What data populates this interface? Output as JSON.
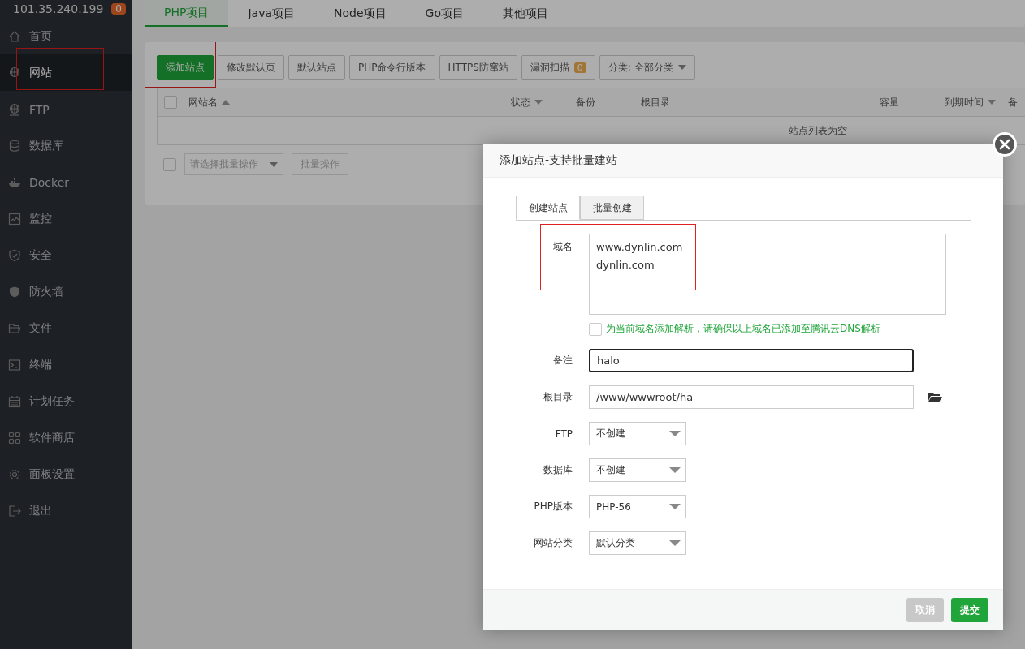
{
  "server": {
    "address": "101.35.240.199",
    "badge": "0"
  },
  "sidebar": {
    "items": [
      {
        "label": "首页",
        "selected": false,
        "highlighted": false
      },
      {
        "label": "网站",
        "selected": true,
        "highlighted": true
      },
      {
        "label": "FTP",
        "selected": false,
        "highlighted": false
      },
      {
        "label": "数据库",
        "selected": false,
        "highlighted": false
      },
      {
        "label": "Docker",
        "selected": false,
        "highlighted": false
      },
      {
        "label": "监控",
        "selected": false,
        "highlighted": false
      },
      {
        "label": "安全",
        "selected": false,
        "highlighted": false
      },
      {
        "label": "防火墙",
        "selected": false,
        "highlighted": false
      },
      {
        "label": "文件",
        "selected": false,
        "highlighted": false
      },
      {
        "label": "终端",
        "selected": false,
        "highlighted": false
      },
      {
        "label": "计划任务",
        "selected": false,
        "highlighted": false
      },
      {
        "label": "软件商店",
        "selected": false,
        "highlighted": false
      },
      {
        "label": "面板设置",
        "selected": false,
        "highlighted": false
      },
      {
        "label": "退出",
        "selected": false,
        "highlighted": false
      }
    ]
  },
  "project_tabs": [
    {
      "label": "PHP项目",
      "selected": true
    },
    {
      "label": "Java项目",
      "selected": false
    },
    {
      "label": "Node项目",
      "selected": false
    },
    {
      "label": "Go项目",
      "selected": false
    },
    {
      "label": "其他项目",
      "selected": false
    }
  ],
  "toolbar": [
    {
      "kind": "primary",
      "label": "添加站点",
      "highlighted": true
    },
    {
      "kind": "button",
      "label": "修改默认页",
      "highlighted": false
    },
    {
      "kind": "button",
      "label": "默认站点",
      "highlighted": false
    },
    {
      "kind": "button",
      "label": "PHP命令行版本",
      "highlighted": false
    },
    {
      "kind": "button",
      "label": "HTTPS防窜站",
      "highlighted": false
    },
    {
      "kind": "badge",
      "label": "漏洞扫描",
      "badge": "0",
      "highlighted": false
    },
    {
      "kind": "select",
      "label": "分类: 全部分类",
      "highlighted": false
    }
  ],
  "table": {
    "columns": [
      {
        "label": "网站名",
        "sort_up": true,
        "sort_down": false
      },
      {
        "label": "状态",
        "sort_up": false,
        "sort_down": true
      },
      {
        "label": "备份",
        "sort_up": false,
        "sort_down": false
      },
      {
        "label": "根目录",
        "sort_up": false,
        "sort_down": false
      },
      {
        "label": "容量",
        "sort_up": false,
        "sort_down": false
      },
      {
        "label": "到期时间",
        "sort_up": false,
        "sort_down": true
      },
      {
        "label": "备",
        "sort_up": false,
        "sort_down": false
      }
    ],
    "empty_text": "站点列表为空",
    "all_checked": false
  },
  "batch": {
    "checked": false,
    "placeholder": "请选择批量操作",
    "button": "批量操作"
  },
  "dialog": {
    "title": "添加站点-支持批量建站",
    "tabs": [
      {
        "label": "创建站点",
        "selected": true
      },
      {
        "label": "批量创建",
        "selected": false
      }
    ],
    "domain": {
      "label": "域名",
      "lines": [
        "www.dynlin.com",
        "dynlin.com"
      ],
      "highlighted": true
    },
    "dns": {
      "checked": false,
      "label": "为当前域名添加解析，请确保以上域名已添加至腾讯云DNS解析"
    },
    "note": {
      "label": "备注",
      "value": "halo",
      "focused": true
    },
    "root": {
      "label": "根目录",
      "value": "/www/wwwroot/ha"
    },
    "selects": [
      {
        "label": "FTP",
        "value": "不创建"
      },
      {
        "label": "数据库",
        "value": "不创建"
      },
      {
        "label": "PHP版本",
        "value": "PHP-56"
      },
      {
        "label": "网站分类",
        "value": "默认分类"
      }
    ],
    "buttons": [
      {
        "kind": "cancel",
        "label": "取消"
      },
      {
        "kind": "submit",
        "label": "提交"
      }
    ]
  }
}
